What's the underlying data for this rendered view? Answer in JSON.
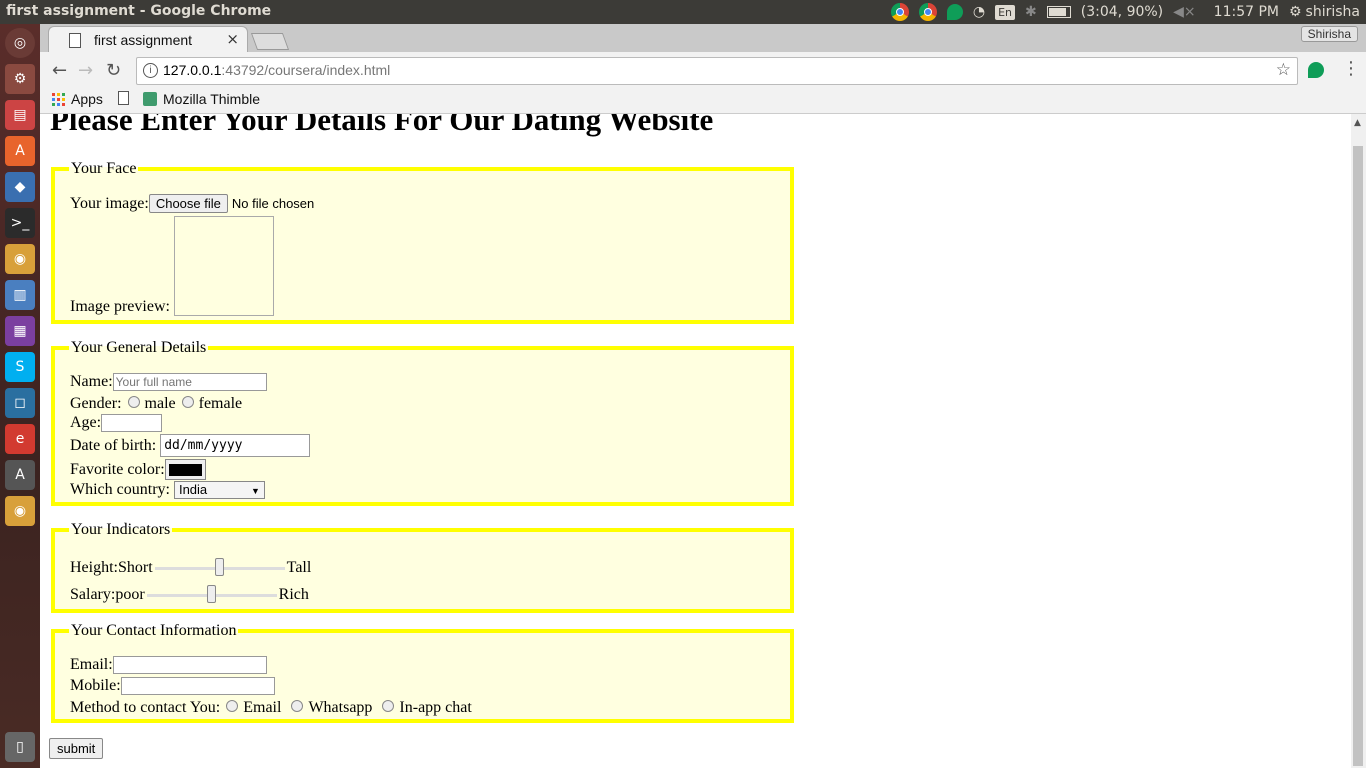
{
  "system": {
    "window_title": "first assignment - Google Chrome",
    "battery": "(3:04, 90%)",
    "keyboard": "En",
    "clock": "11:57 PM",
    "user": "shirisha"
  },
  "browser": {
    "tab_title": "first assignment",
    "tab_close": "×",
    "profile": "Shirisha",
    "url_host": "127.0.0.1",
    "url_rest": ":43792/coursera/index.html",
    "bookmarks": [
      {
        "label": "Apps"
      },
      {
        "label": ""
      },
      {
        "label": "Mozilla Thimble"
      }
    ]
  },
  "page": {
    "heading": "Please Enter Your Details For Our Dating Website",
    "face": {
      "legend": "Your Face",
      "image_label": "Your image:",
      "choose_button": "Choose file",
      "no_file": "No file chosen",
      "preview_label": "Image preview:"
    },
    "general": {
      "legend": "Your General Details",
      "name_label": "Name:",
      "name_placeholder": "Your full name",
      "gender_label": "Gender:",
      "gender_options": [
        "male",
        "female"
      ],
      "age_label": "Age:",
      "dob_label": "Date of birth:",
      "dob_value": "dd/mm/yyyy",
      "color_label": "Favorite color:",
      "color_value": "#000000",
      "country_label": "Which country:",
      "country_value": "India"
    },
    "indicators": {
      "legend": "Your Indicators",
      "height_label": "Height:Short",
      "height_end": "Tall",
      "height_value": 0.5,
      "salary_label": "Salary:poor",
      "salary_end": "Rich",
      "salary_value": 0.5
    },
    "contact": {
      "legend": "Your Contact Information",
      "email_label": "Email:",
      "mobile_label": "Mobile:",
      "method_label": "Method to contact You:",
      "method_options": [
        "Email",
        "Whatsapp",
        "In-app chat"
      ]
    },
    "submit": "submit"
  }
}
